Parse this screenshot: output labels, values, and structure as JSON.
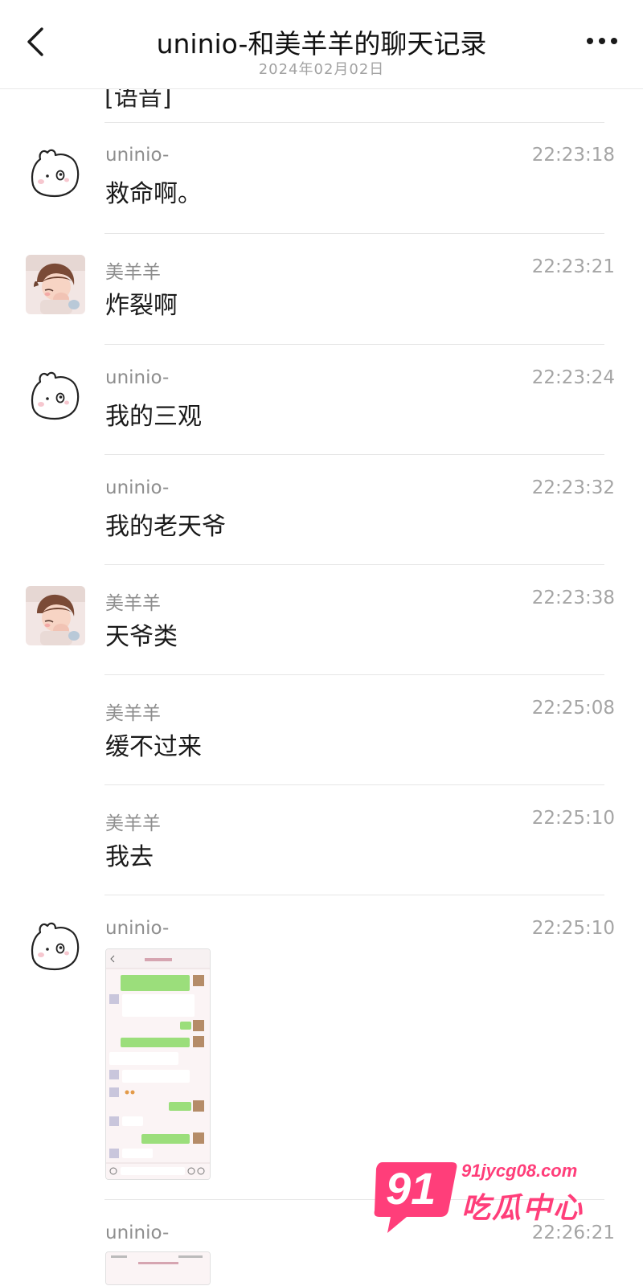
{
  "header": {
    "title": "uninio-和美羊羊的聊天记录",
    "date": "2024年02月02日",
    "back_icon": "chevron-left-icon",
    "more_icon": "more-dots-icon"
  },
  "partial_top_text": "[语音]",
  "messages": [
    {
      "sender": "uninio-",
      "time": "22:23:18",
      "text": "救命啊。",
      "avatar": "bunny-avatar"
    },
    {
      "sender": "美羊羊",
      "time": "22:23:21",
      "text": "炸裂啊",
      "avatar": "girl-photo-avatar"
    },
    {
      "sender": "uninio-",
      "time": "22:23:24",
      "text": "我的三观",
      "avatar": "bunny-avatar"
    },
    {
      "sender": "uninio-",
      "time": "22:23:32",
      "text": "我的老天爷",
      "avatar": ""
    },
    {
      "sender": "美羊羊",
      "time": "22:23:38",
      "text": "天爷类",
      "avatar": "girl-photo-avatar"
    },
    {
      "sender": "美羊羊",
      "time": "22:25:08",
      "text": "缓不过来",
      "avatar": ""
    },
    {
      "sender": "美羊羊",
      "time": "22:25:10",
      "text": "我去",
      "avatar": ""
    },
    {
      "sender": "uninio-",
      "time": "22:25:10",
      "text": "",
      "avatar": "bunny-avatar",
      "attachment": "chat-screenshot-image"
    },
    {
      "sender": "uninio-",
      "time": "22:26:21",
      "text": "",
      "avatar": "",
      "attachment": "chat-screenshot-image"
    }
  ],
  "watermark": {
    "logo": "91",
    "url": "91jycg08.com",
    "name": "吃瓜中心"
  },
  "colors": {
    "accent_pink": "#ff3e7a",
    "bubble_green": "#95ec69",
    "meta_gray": "#a5a5a5"
  }
}
